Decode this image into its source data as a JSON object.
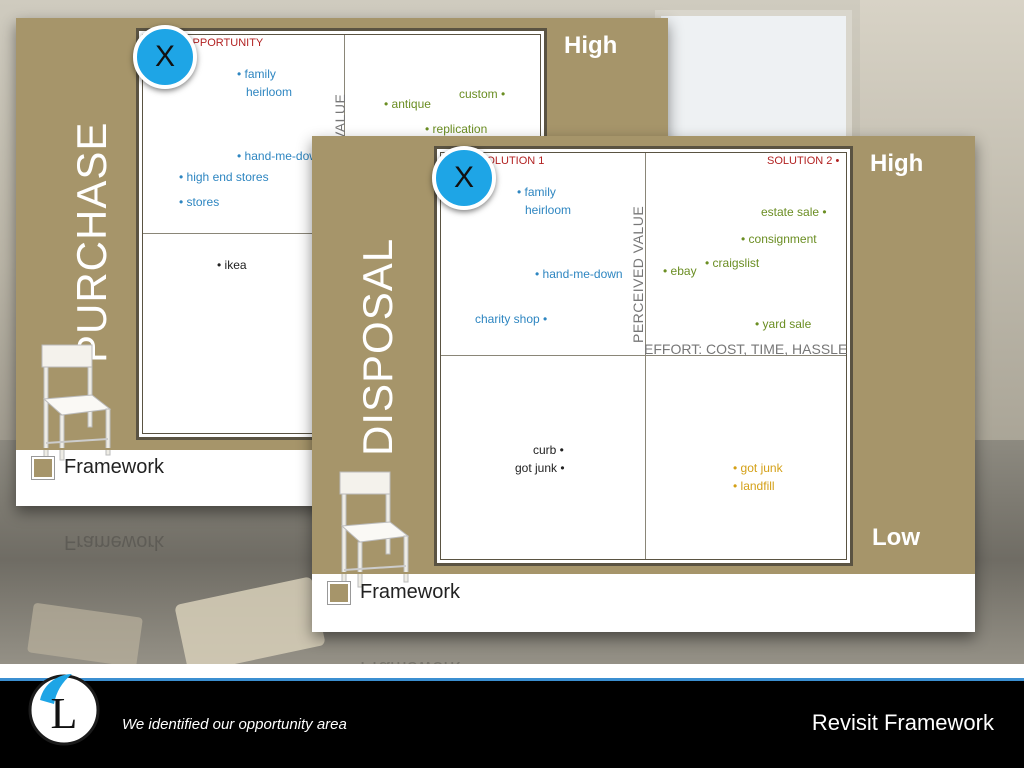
{
  "back_slide": {
    "title": "PURCHASE",
    "high_label": "High",
    "corner_label": "OPPORTUNITY",
    "axis_value": "VALUE",
    "points_left": [
      "family",
      "heirloom",
      "hand-me-down",
      "high end stores",
      "stores",
      "ikea"
    ],
    "points_right": [
      "antique",
      "custom",
      "replication"
    ],
    "footer": "Framework",
    "footer_reflection": "Framework"
  },
  "front_slide": {
    "title": "DISPOSAL",
    "high_label": "High",
    "low_label": "Low",
    "solution1": "SOLUTION 1",
    "solution2": "SOLUTION 2",
    "axis_vertical": "PERCEIVED VALUE",
    "axis_horizontal": "EFFORT: COST, TIME, HASSLE",
    "top_left": [
      "family",
      "heirloom",
      "hand-me-down",
      "charity shop"
    ],
    "top_right": [
      "estate sale",
      "consignment",
      "craigslist",
      "ebay",
      "yard sale"
    ],
    "bottom_left": [
      "curb",
      "got junk"
    ],
    "bottom_right": [
      "got junk",
      "landfill"
    ],
    "footer": "Framework",
    "footer_reflection": "Framework"
  },
  "badges": {
    "back": "X",
    "front": "X"
  },
  "bottom_bar": {
    "logo_letter": "L",
    "tagline": "We identified our opportunity area",
    "title": "Revisit Framework"
  },
  "colors": {
    "band": "#a6956a",
    "accent_blue": "#1ea5e6",
    "point_blue": "#2e86c1",
    "point_green": "#6b8e23",
    "point_orange": "#d4a017"
  }
}
